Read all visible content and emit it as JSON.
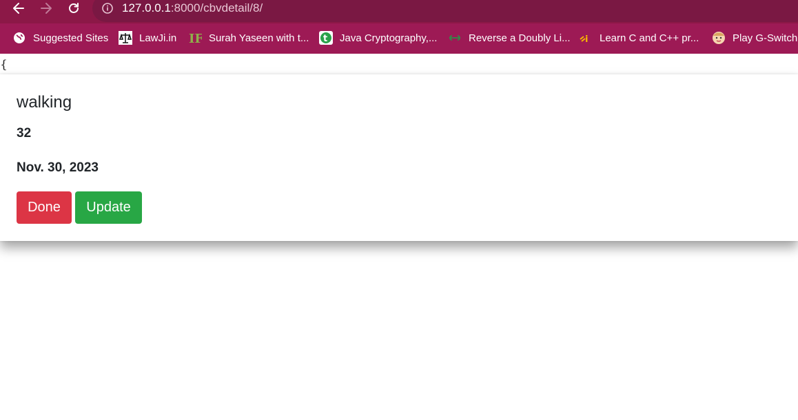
{
  "browser": {
    "url_host": "127.0.0.1",
    "url_rest": ":8000/cbvdetail/8/"
  },
  "bookmarks": [
    {
      "label": "Suggested Sites",
      "icon": "globe-icon"
    },
    {
      "label": "LawJi.in",
      "icon": "scales-icon"
    },
    {
      "label": "Surah Yaseen with t...",
      "icon": "if-logo-icon"
    },
    {
      "label": "Java Cryptography,...",
      "icon": "green-circle-icon"
    },
    {
      "label": "Reverse a Doubly Li...",
      "icon": "geeksforgeeks-icon"
    },
    {
      "label": "Learn C and C++ pr...",
      "icon": "orange-logo-icon"
    },
    {
      "label": "Play G-Switch",
      "icon": "face-icon"
    }
  ],
  "page": {
    "brace": "{",
    "task": {
      "title": "walking",
      "count": "32",
      "date": "Nov. 30, 2023"
    },
    "buttons": {
      "done": "Done",
      "update": "Update"
    }
  },
  "colors": {
    "toolbar": "#8c1847",
    "bookmarks_bar": "#9d1a55",
    "done": "#dc3545",
    "update": "#28a745"
  }
}
